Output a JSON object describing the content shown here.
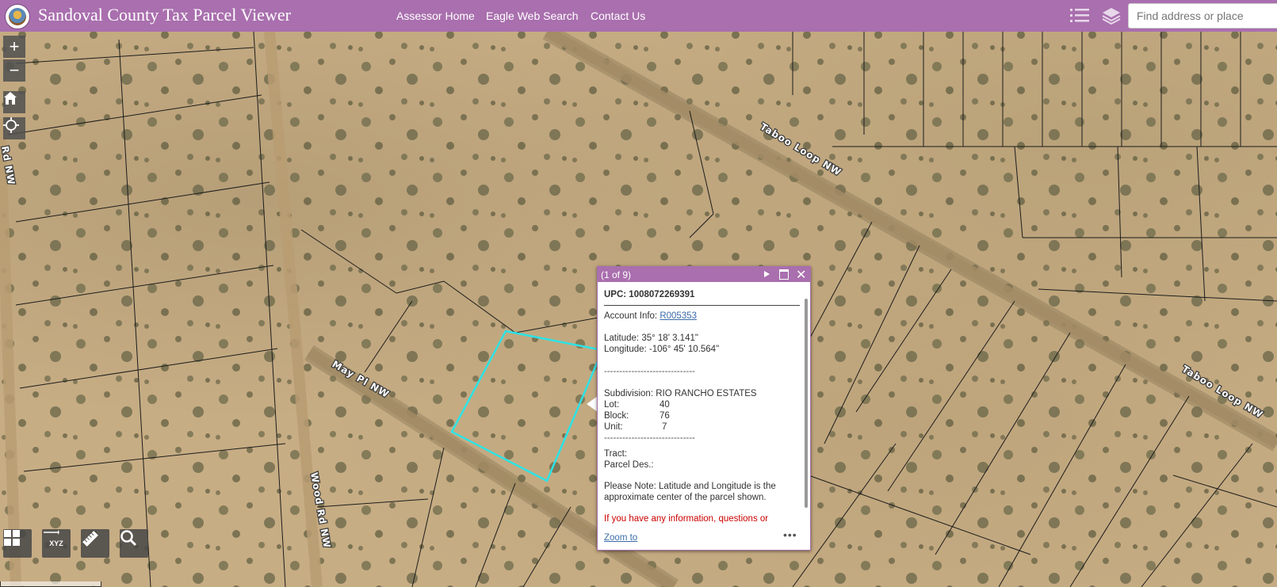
{
  "header": {
    "title": "Sandoval County Tax Parcel Viewer",
    "nav": [
      "Assessor Home",
      "Eagle Web Search",
      "Contact Us"
    ],
    "search_placeholder": "Find address or place",
    "icons": [
      "county-seal-logo",
      "legend-list-icon",
      "layers-icon"
    ],
    "colors": {
      "header": "#a96fae",
      "parcel_highlight": "#2de3e6"
    }
  },
  "map": {
    "roads": [
      "Taboo Loop NW",
      "Taboo Loop NW",
      "May Pl NW",
      "Wood Rd NW",
      "Rd NW"
    ],
    "controls": {
      "zoom_in": "+",
      "zoom_out": "−",
      "home_icon": "home-icon",
      "locate_icon": "locate-icon",
      "bottom_tools": [
        "basemap-gallery-icon",
        "coordinate-xyz-icon",
        "measure-ruler-icon",
        "search-magnifier-icon"
      ],
      "coordinate_label": "XYZ"
    }
  },
  "popup": {
    "count": "(1 of 9)",
    "upc": "UPC: 1008072269391",
    "account_label": "Account Info: ",
    "account_link": "R005353",
    "latitude": "Latitude: 35° 18' 3.141\"",
    "longitude": "Longitude: -106° 45' 10.564\"",
    "divider": "------------------------------",
    "subdivision": "Subdivision: RIO RANCHO ESTATES",
    "lot_label": "Lot:",
    "lot_value": "40",
    "block_label": "Block:",
    "block_value": "76",
    "unit_label": "Unit:",
    "unit_value": "7",
    "tract": "Tract:",
    "parcel_des": "Parcel Des.:",
    "note": "Please Note: Latitude and Longitude is the approximate center of the parcel shown.",
    "contact": "If you have any information, questions or concerns about this parcel, please contact",
    "zoom_to": "Zoom to",
    "more": "•••"
  }
}
